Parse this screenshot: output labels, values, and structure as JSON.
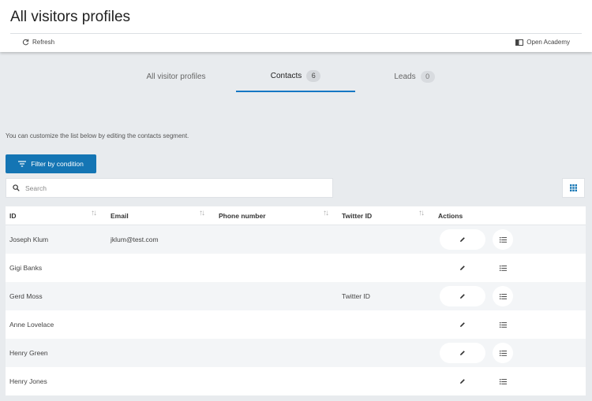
{
  "header": {
    "title": "All visitors profiles",
    "refresh_label": "Refresh",
    "academy_label": "Open Academy"
  },
  "tabs": [
    {
      "label": "All visitor profiles",
      "count": null
    },
    {
      "label": "Contacts",
      "count": "6"
    },
    {
      "label": "Leads",
      "count": "0"
    }
  ],
  "hint": "You can customize the list below by editing the contacts segment.",
  "filter_button": "Filter by condition",
  "search": {
    "placeholder": "Search",
    "value": ""
  },
  "table": {
    "columns": [
      "ID",
      "Email",
      "Phone number",
      "Twitter ID",
      "Actions"
    ],
    "rows": [
      {
        "id": "Joseph Klum",
        "email": "jklum@test.com",
        "phone": "",
        "twitter": ""
      },
      {
        "id": "Gigi Banks",
        "email": "",
        "phone": "",
        "twitter": ""
      },
      {
        "id": "Gerd Moss",
        "email": "",
        "phone": "",
        "twitter": "Twitter ID"
      },
      {
        "id": "Anne Lovelace",
        "email": "",
        "phone": "",
        "twitter": ""
      },
      {
        "id": "Henry Green",
        "email": "",
        "phone": "",
        "twitter": ""
      },
      {
        "id": "Henry Jones",
        "email": "",
        "phone": "",
        "twitter": ""
      }
    ]
  },
  "icons": {
    "refresh": "refresh-icon",
    "academy": "book-icon",
    "filter": "filter-icon",
    "search": "search-icon",
    "grid": "grid-icon",
    "sort": "sort-icon",
    "edit": "pencil-icon",
    "list": "list-icon"
  },
  "colors": {
    "accent": "#1475b4",
    "tab_underline": "#1577c4"
  }
}
